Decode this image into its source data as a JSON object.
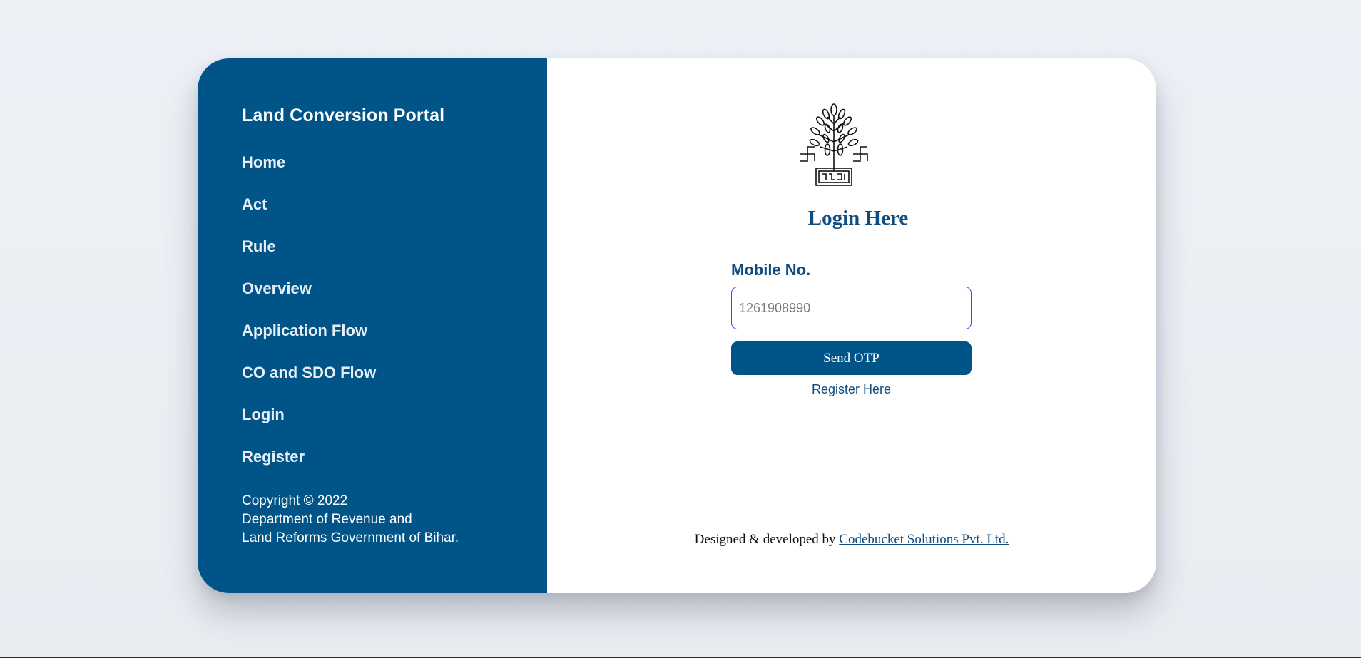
{
  "sidebar": {
    "brand": "Land Conversion Portal",
    "items": [
      {
        "label": "Home"
      },
      {
        "label": "Act"
      },
      {
        "label": "Rule"
      },
      {
        "label": "Overview"
      },
      {
        "label": "Application Flow"
      },
      {
        "label": "CO and SDO Flow"
      },
      {
        "label": "Login"
      },
      {
        "label": "Register"
      }
    ],
    "copyright": {
      "line1": "Copyright © 2022",
      "line2": "Department of Revenue and",
      "line3": "Land Reforms Government of Bihar."
    }
  },
  "login": {
    "emblem_icon": "bihar-emblem-bodhi-tree-icon",
    "title": "Login Here",
    "mobile_label": "Mobile No.",
    "mobile_placeholder": "1261908990",
    "send_otp_label": "Send OTP",
    "register_label": "Register Here"
  },
  "footer": {
    "prefix": "Designed & developed by ",
    "company": "Codebucket Solutions Pvt. Ltd."
  },
  "colors": {
    "sidebar_bg": "#015488",
    "accent": "#0e4d82",
    "input_border": "#6a3fd8",
    "page_bg": "#edf0f5"
  }
}
